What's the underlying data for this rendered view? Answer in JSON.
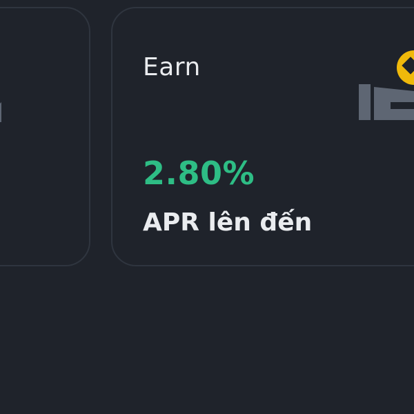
{
  "cards": {
    "earn": {
      "title": "Earn",
      "rate": "2.80%",
      "rate_label": "APR lên đến"
    }
  },
  "icons": {
    "left_card": "savings-coins-icon",
    "earn_card": "earn-hand-coin-icon"
  },
  "colors": {
    "background": "#1f232b",
    "card_border": "#2f353f",
    "text_primary": "#eaecef",
    "positive": "#2ebd85",
    "coin": "#f0b90b",
    "illustration_gray": "#5e6673"
  }
}
